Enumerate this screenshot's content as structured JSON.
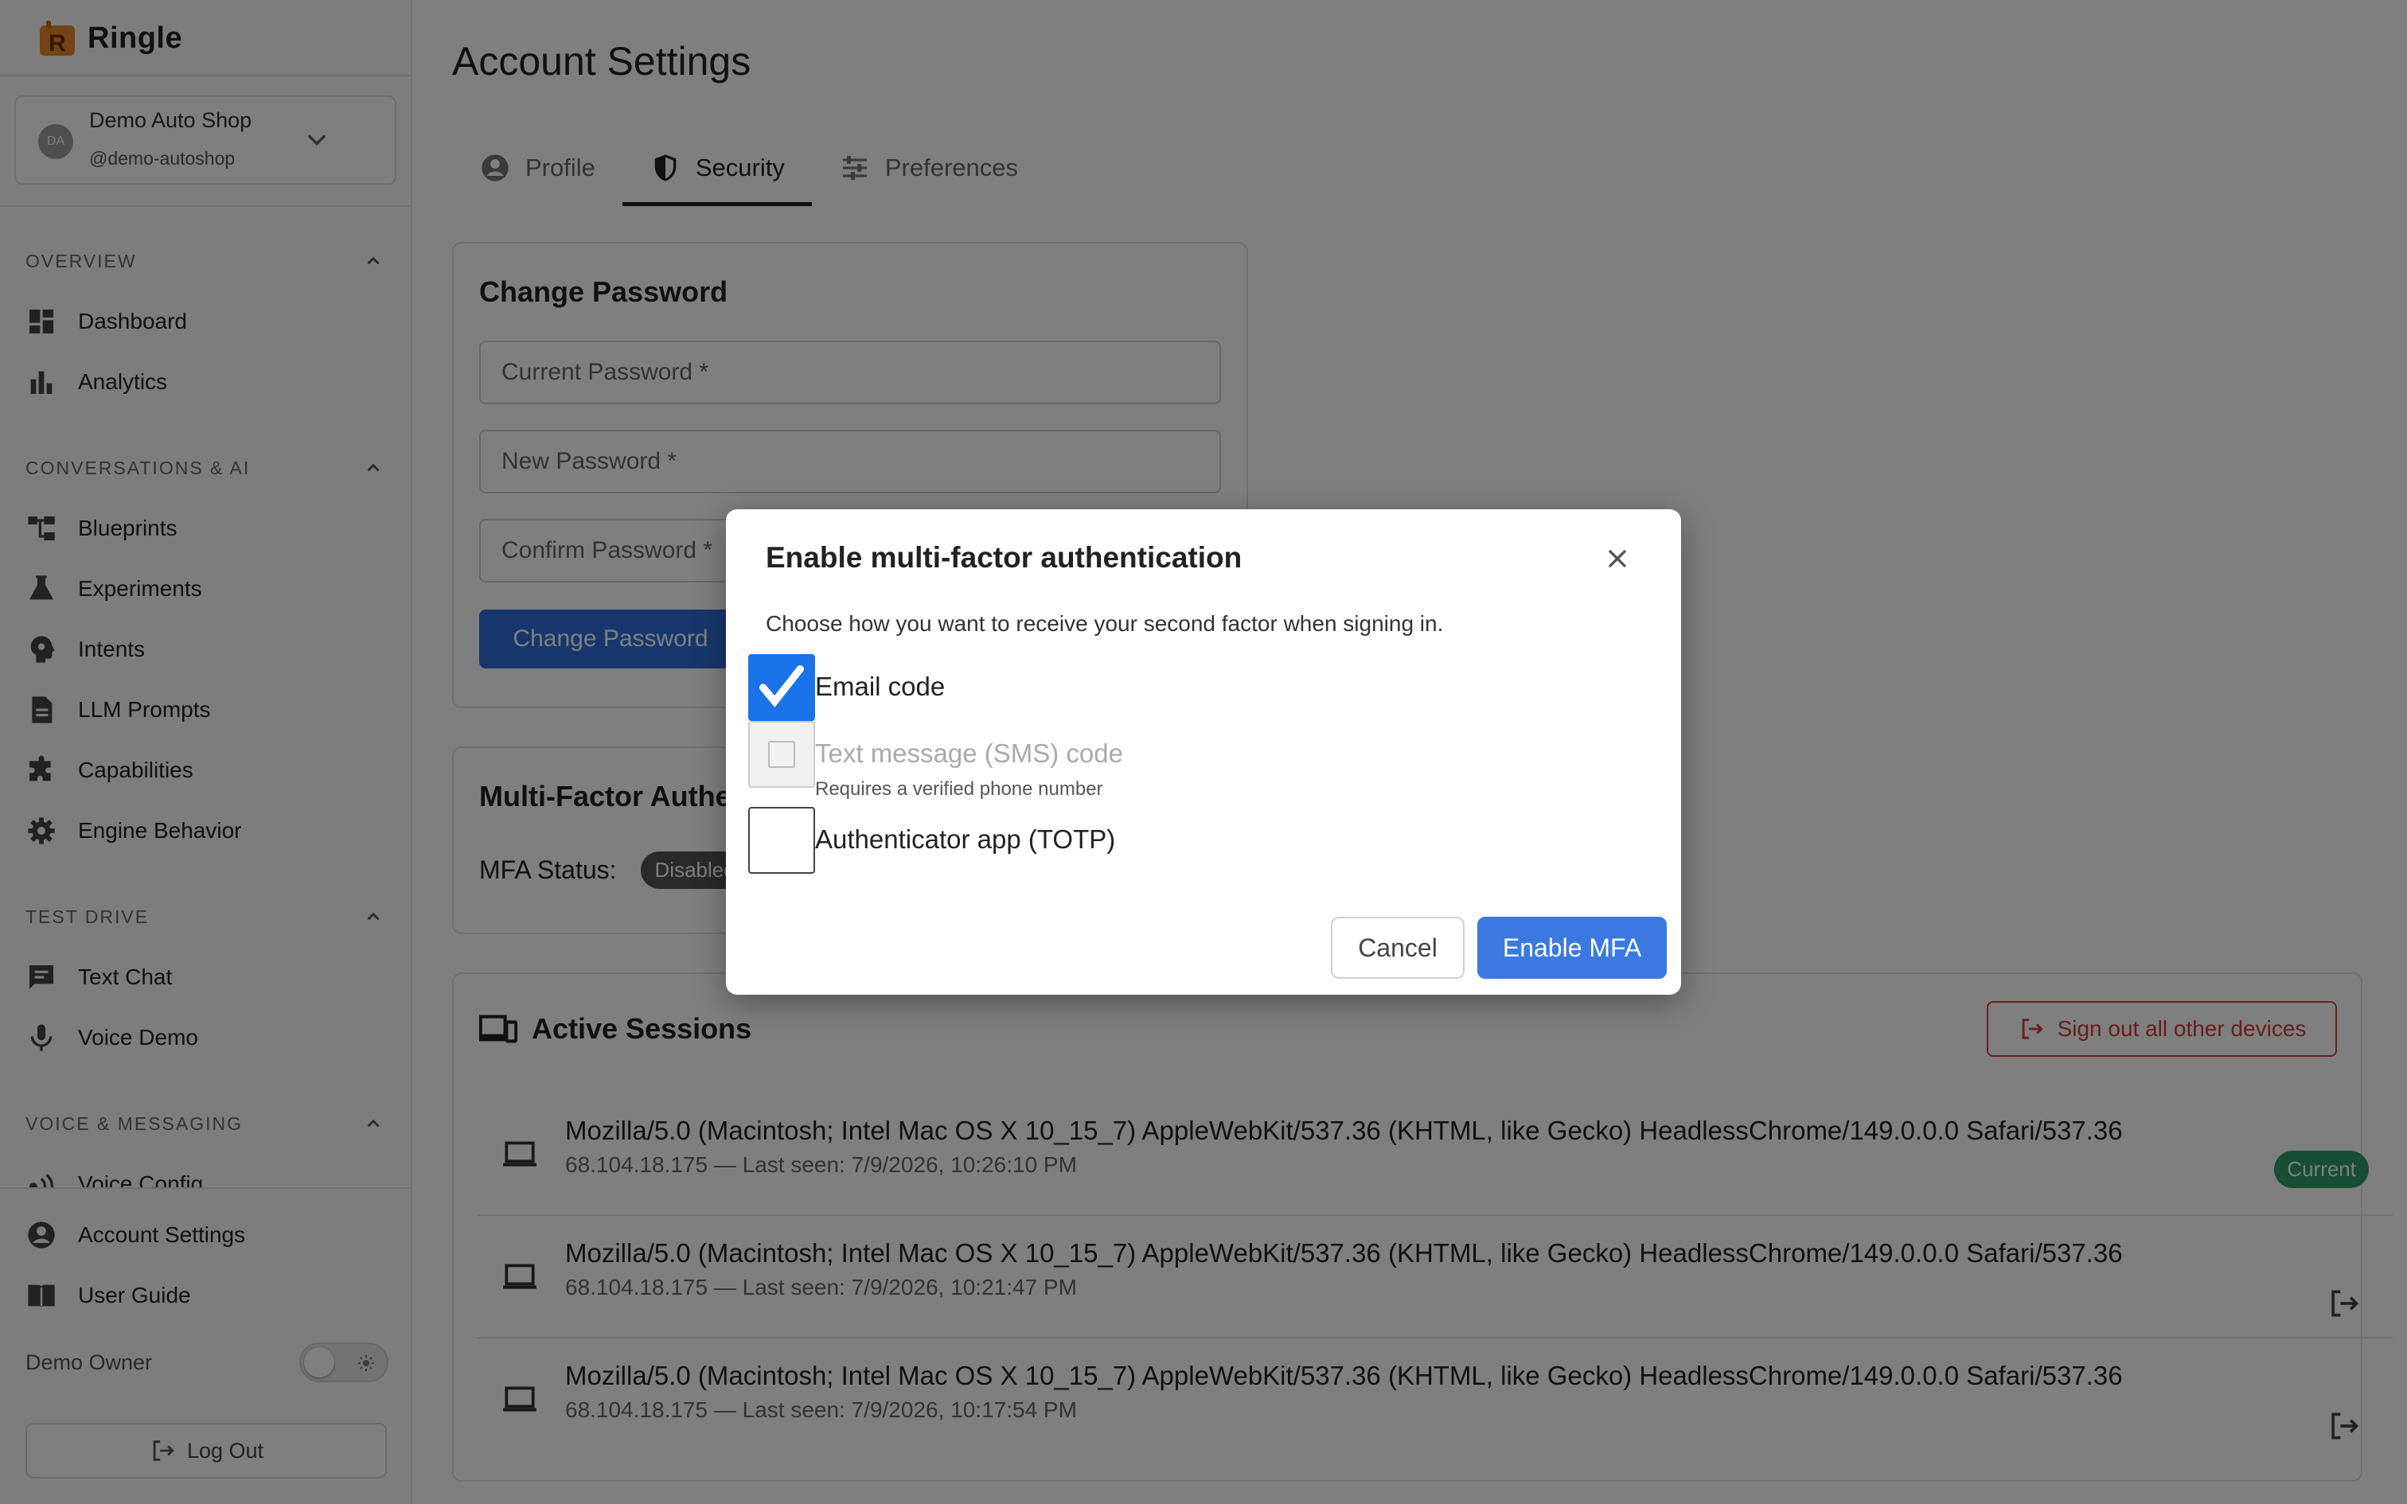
{
  "brand": {
    "name": "Ringle",
    "logo_letter": "R"
  },
  "account": {
    "initials": "DA",
    "name": "Demo Auto Shop",
    "handle": "@demo-autoshop"
  },
  "sidebar": {
    "sections": [
      {
        "title": "OVERVIEW",
        "items": [
          {
            "label": "Dashboard",
            "icon": "dashboard-icon"
          },
          {
            "label": "Analytics",
            "icon": "bar-chart-icon"
          }
        ]
      },
      {
        "title": "CONVERSATIONS & AI",
        "items": [
          {
            "label": "Blueprints",
            "icon": "blueprint-icon"
          },
          {
            "label": "Experiments",
            "icon": "flask-icon"
          },
          {
            "label": "Intents",
            "icon": "brain-icon"
          },
          {
            "label": "LLM Prompts",
            "icon": "document-icon"
          },
          {
            "label": "Capabilities",
            "icon": "puzzle-icon"
          },
          {
            "label": "Engine Behavior",
            "icon": "gear-icon"
          }
        ]
      },
      {
        "title": "TEST DRIVE",
        "items": [
          {
            "label": "Text Chat",
            "icon": "chat-icon"
          },
          {
            "label": "Voice Demo",
            "icon": "microphone-icon"
          }
        ]
      },
      {
        "title": "VOICE & MESSAGING",
        "items": [
          {
            "label": "Voice Config",
            "icon": "voice-icon"
          }
        ]
      }
    ],
    "bottom": {
      "account_settings": "Account Settings",
      "user_guide": "User Guide",
      "owner": "Demo Owner",
      "logout": "Log Out"
    }
  },
  "main": {
    "title": "Account Settings",
    "tabs": [
      {
        "label": "Profile",
        "active": false
      },
      {
        "label": "Security",
        "active": true
      },
      {
        "label": "Preferences",
        "active": false
      }
    ],
    "change_password": {
      "title": "Change Password",
      "current_placeholder": "Current Password *",
      "new_placeholder": "New Password *",
      "confirm_placeholder": "Confirm Password *",
      "button": "Change Password"
    },
    "mfa": {
      "title": "Multi-Factor Authentication",
      "status_label": "MFA Status:",
      "status_value": "Disabled"
    },
    "sessions": {
      "title": "Active Sessions",
      "signout_all": "Sign out all other devices",
      "current_label": "Current",
      "rows": [
        {
          "ua": "Mozilla/5.0 (Macintosh; Intel Mac OS X 10_15_7) AppleWebKit/537.36 (KHTML, like Gecko) HeadlessChrome/149.0.0.0 Safari/537.36",
          "meta": "68.104.18.175 — Last seen: 7/9/2026, 10:26:10 PM",
          "current": true
        },
        {
          "ua": "Mozilla/5.0 (Macintosh; Intel Mac OS X 10_15_7) AppleWebKit/537.36 (KHTML, like Gecko) HeadlessChrome/149.0.0.0 Safari/537.36",
          "meta": "68.104.18.175 — Last seen: 7/9/2026, 10:21:47 PM",
          "current": false
        },
        {
          "ua": "Mozilla/5.0 (Macintosh; Intel Mac OS X 10_15_7) AppleWebKit/537.36 (KHTML, like Gecko) HeadlessChrome/149.0.0.0 Safari/537.36",
          "meta": "68.104.18.175 — Last seen: 7/9/2026, 10:17:54 PM",
          "current": false
        }
      ]
    }
  },
  "modal": {
    "title": "Enable multi-factor authentication",
    "description": "Choose how you want to receive your second factor when signing in.",
    "options": [
      {
        "label": "Email code",
        "checked": true,
        "disabled": false
      },
      {
        "label": "Text message (SMS) code",
        "checked": false,
        "disabled": true,
        "hint": "Requires a verified phone number"
      },
      {
        "label": "Authenticator app (TOTP)",
        "checked": false,
        "disabled": false
      }
    ],
    "cancel": "Cancel",
    "confirm": "Enable MFA"
  },
  "colors": {
    "primary": "#2f6fd8",
    "checkbox": "#1a73e8",
    "danger": "#d43d3d",
    "success": "#2e9d6b"
  }
}
